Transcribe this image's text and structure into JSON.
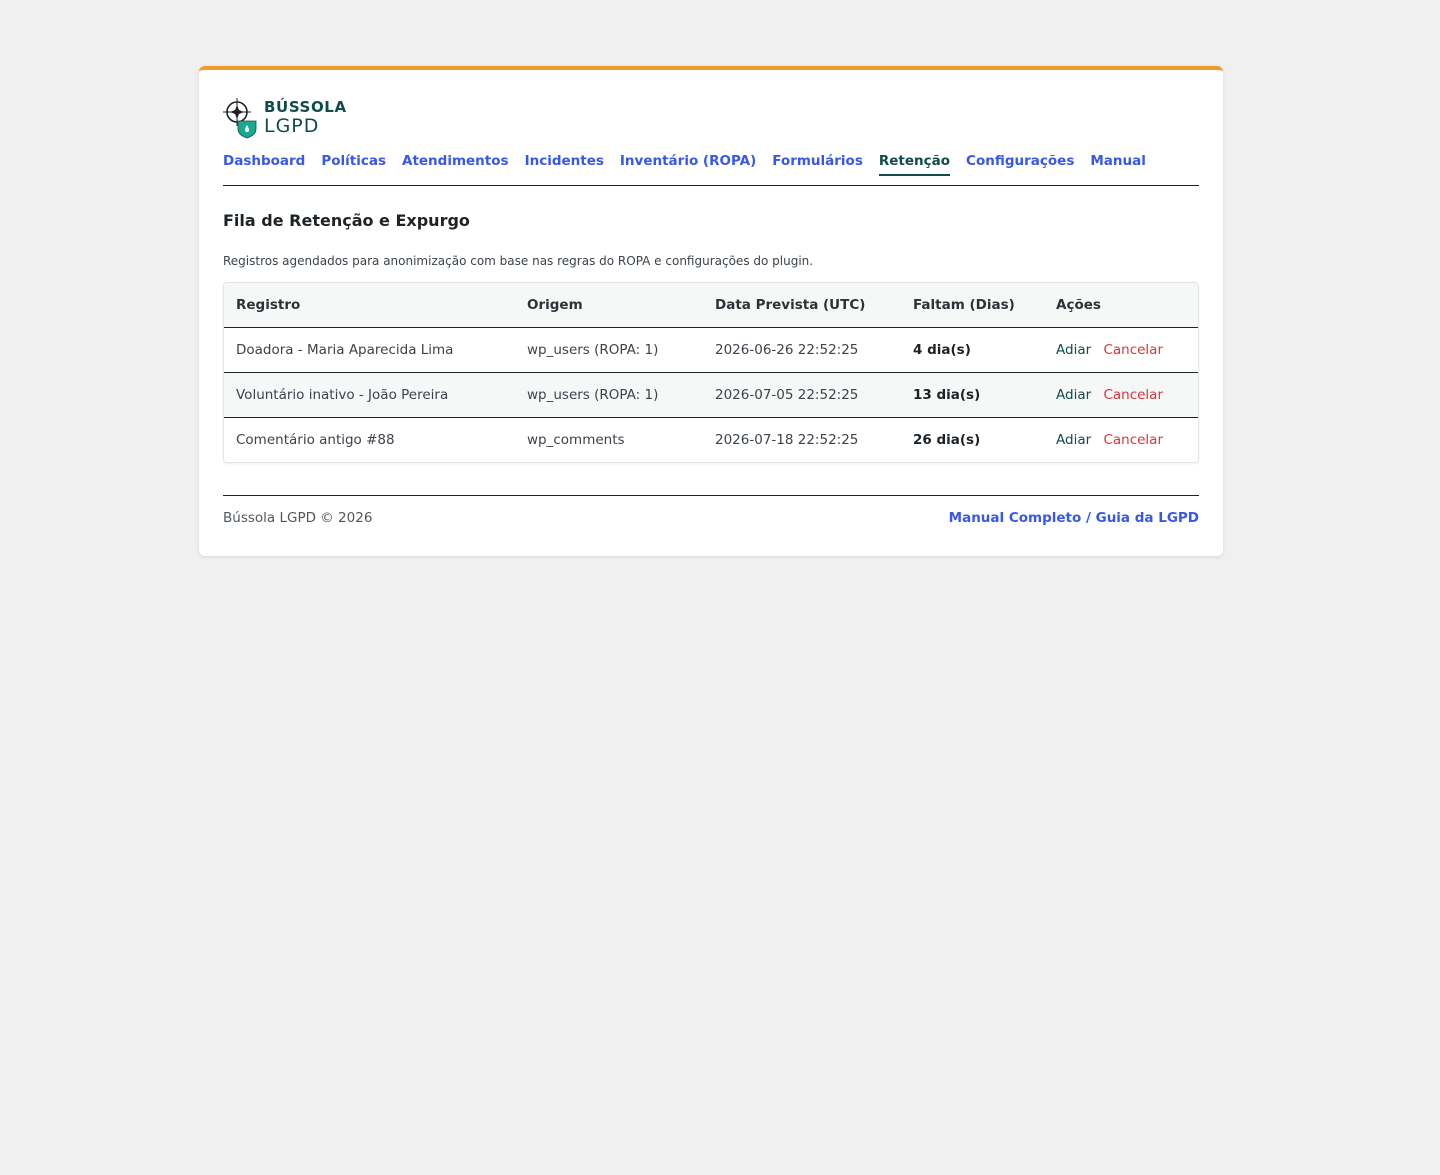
{
  "brand": {
    "line1": "BÚSSOLA",
    "line2": "LGPD",
    "colors": {
      "accent": "#f29a2e",
      "primary": "#0f4c4a",
      "shield": "#1aa890",
      "link": "#3858e9",
      "danger": "#d63638"
    }
  },
  "nav": {
    "items": [
      {
        "label": "Dashboard"
      },
      {
        "label": "Políticas"
      },
      {
        "label": "Atendimentos"
      },
      {
        "label": "Incidentes"
      },
      {
        "label": "Inventário (ROPA)"
      },
      {
        "label": "Formulários"
      },
      {
        "label": "Retenção"
      },
      {
        "label": "Configurações"
      },
      {
        "label": "Manual"
      }
    ],
    "active": "Retenção"
  },
  "page": {
    "title": "Fila de Retenção e Expurgo",
    "description": "Registros agendados para anonimização com base nas regras do ROPA e configurações do plugin."
  },
  "table": {
    "headers": [
      "Registro",
      "Origem",
      "Data Prevista (UTC)",
      "Faltam (Dias)",
      "Ações"
    ],
    "rows": [
      {
        "registro": "Doadora - Maria Aparecida Lima",
        "origem": "wp_users (ROPA: 1)",
        "data": "2026-06-26 22:52:25",
        "faltam": "4 dia(s)",
        "adiar": "Adiar",
        "cancelar": "Cancelar"
      },
      {
        "registro": "Voluntário inativo - João Pereira",
        "origem": "wp_users (ROPA: 1)",
        "data": "2026-07-05 22:52:25",
        "faltam": "13 dia(s)",
        "adiar": "Adiar",
        "cancelar": "Cancelar"
      },
      {
        "registro": "Comentário antigo #88",
        "origem": "wp_comments",
        "data": "2026-07-18 22:52:25",
        "faltam": "26 dia(s)",
        "adiar": "Adiar",
        "cancelar": "Cancelar"
      }
    ]
  },
  "footer": {
    "copyright": "Bússola LGPD © 2026",
    "manual_link": "Manual Completo / Guia da LGPD"
  }
}
